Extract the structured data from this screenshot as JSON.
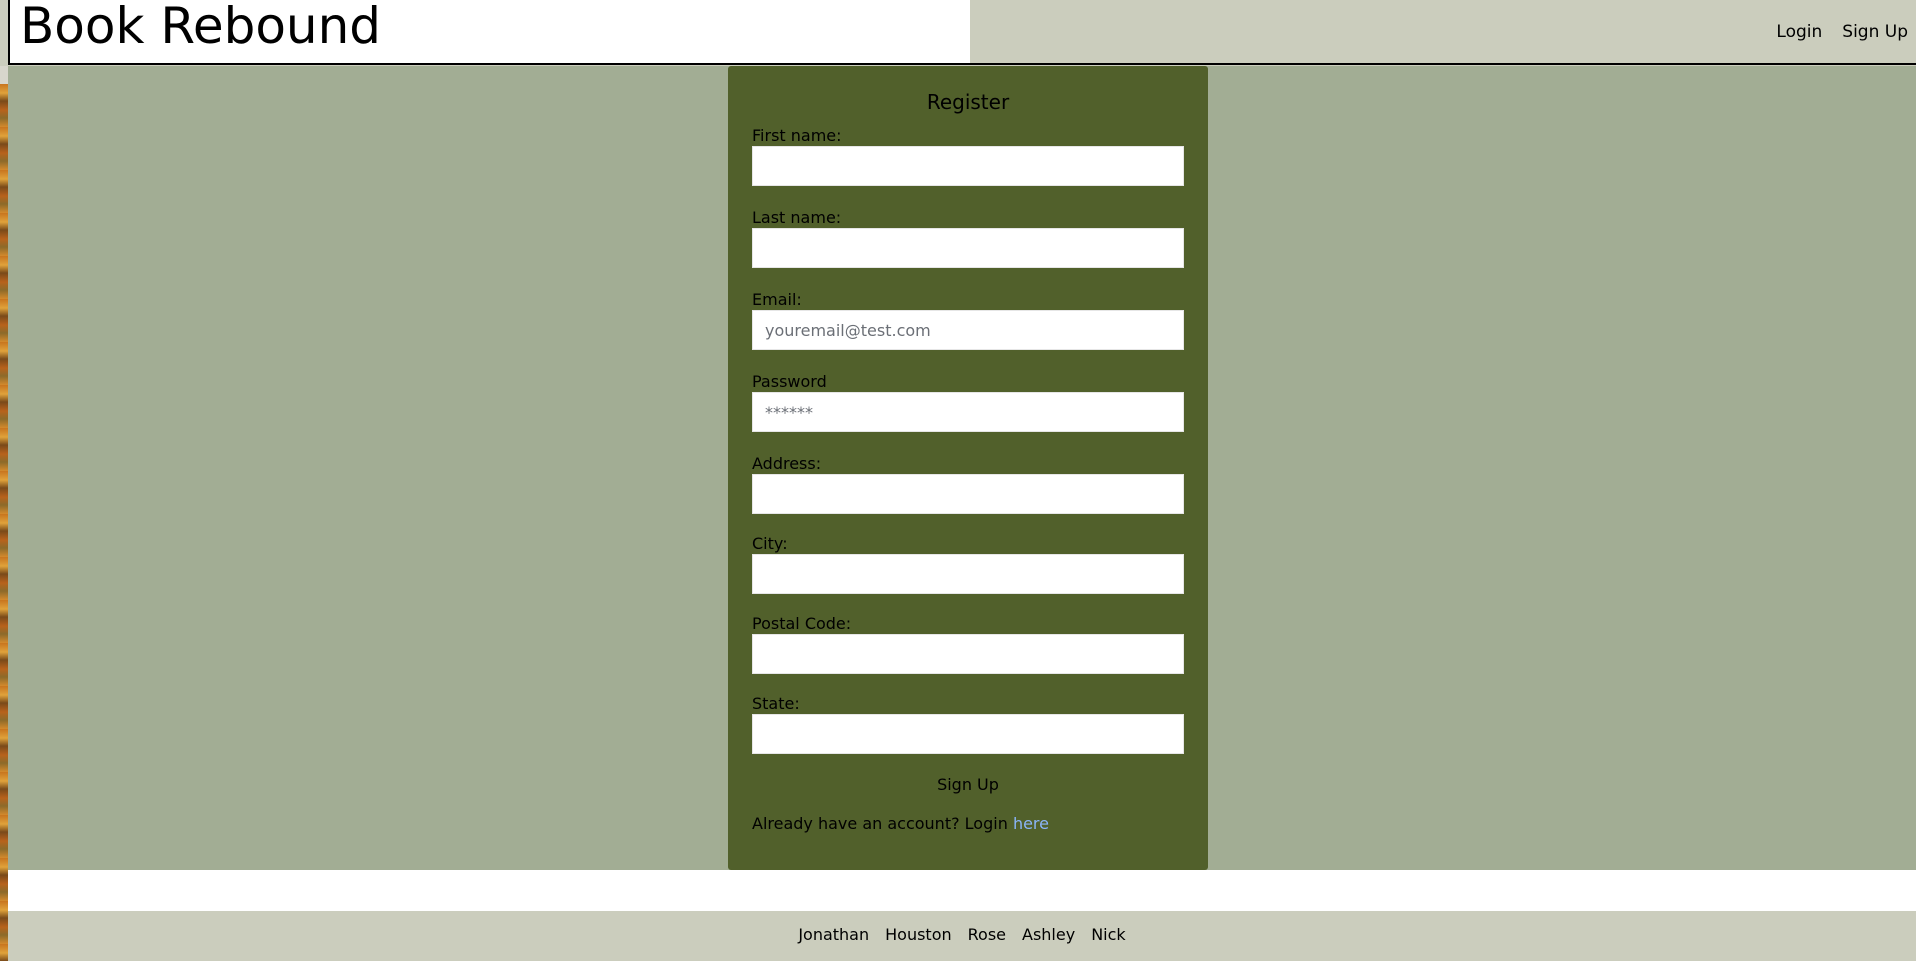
{
  "header": {
    "brand": "Book Rebound",
    "nav": [
      {
        "label": "Login"
      },
      {
        "label": "Sign Up"
      }
    ]
  },
  "register": {
    "title": "Register",
    "fields": [
      {
        "label": "First name:",
        "placeholder": "",
        "value": ""
      },
      {
        "label": "Last name:",
        "placeholder": "",
        "value": ""
      },
      {
        "label": "Email:",
        "placeholder": "youremail@test.com",
        "value": ""
      },
      {
        "label": "Password",
        "placeholder": "******",
        "value": ""
      },
      {
        "label": "Address:",
        "placeholder": "",
        "value": ""
      },
      {
        "label": "City:",
        "placeholder": "",
        "value": ""
      },
      {
        "label": "Postal Code:",
        "placeholder": "",
        "value": ""
      },
      {
        "label": "State:",
        "placeholder": "",
        "value": ""
      }
    ],
    "submit_label": "Sign Up",
    "login_prompt": "Already have an account? Login",
    "login_link": "here"
  },
  "footer": {
    "names": [
      "Jonathan",
      "Houston",
      "Rose",
      "Ashley",
      "Nick"
    ]
  },
  "colors": {
    "header_bg": "#cbcdbd",
    "page_bg": "#a2ad94",
    "card_bg": "#51602b",
    "link": "#8ab4f8"
  }
}
